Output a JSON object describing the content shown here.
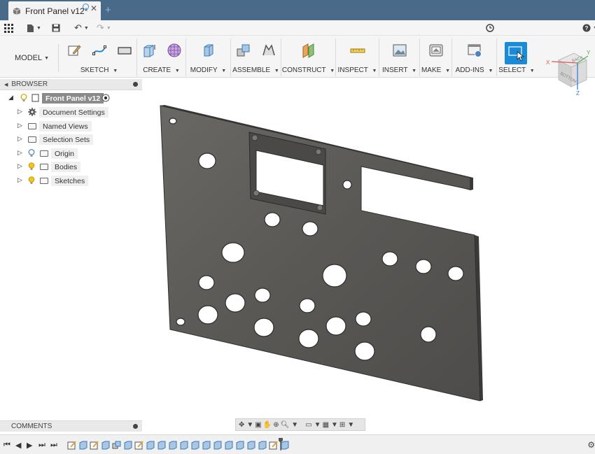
{
  "document": {
    "title": "Front Panel v12*"
  },
  "toolbar": {
    "workspace": "MODEL",
    "groups": [
      "SKETCH",
      "CREATE",
      "MODIFY",
      "ASSEMBLE",
      "CONSTRUCT",
      "INSPECT",
      "INSERT",
      "MAKE",
      "ADD-INS",
      "SELECT"
    ]
  },
  "viewcube": {
    "back": "BACK",
    "bottom": "BOTTOM",
    "axis_x": "X",
    "axis_y": "Y",
    "axis_z": "Z"
  },
  "browser": {
    "title": "BROWSER",
    "root": "Front Panel v12",
    "items": [
      "Document Settings",
      "Named Views",
      "Selection Sets",
      "Origin",
      "Bodies",
      "Sketches"
    ]
  },
  "comments": {
    "title": "COMMENTS"
  },
  "colors": {
    "accent": "#1a8bd6",
    "tabbar": "#4a6a8a",
    "part": "#5c5a58",
    "bulb": "#f5c518"
  },
  "icons": {
    "apps": "grid-icon",
    "file": "file-icon",
    "save": "save-icon",
    "undo": "undo-icon",
    "redo": "redo-icon",
    "history": "clock-icon",
    "help": "help-icon"
  }
}
